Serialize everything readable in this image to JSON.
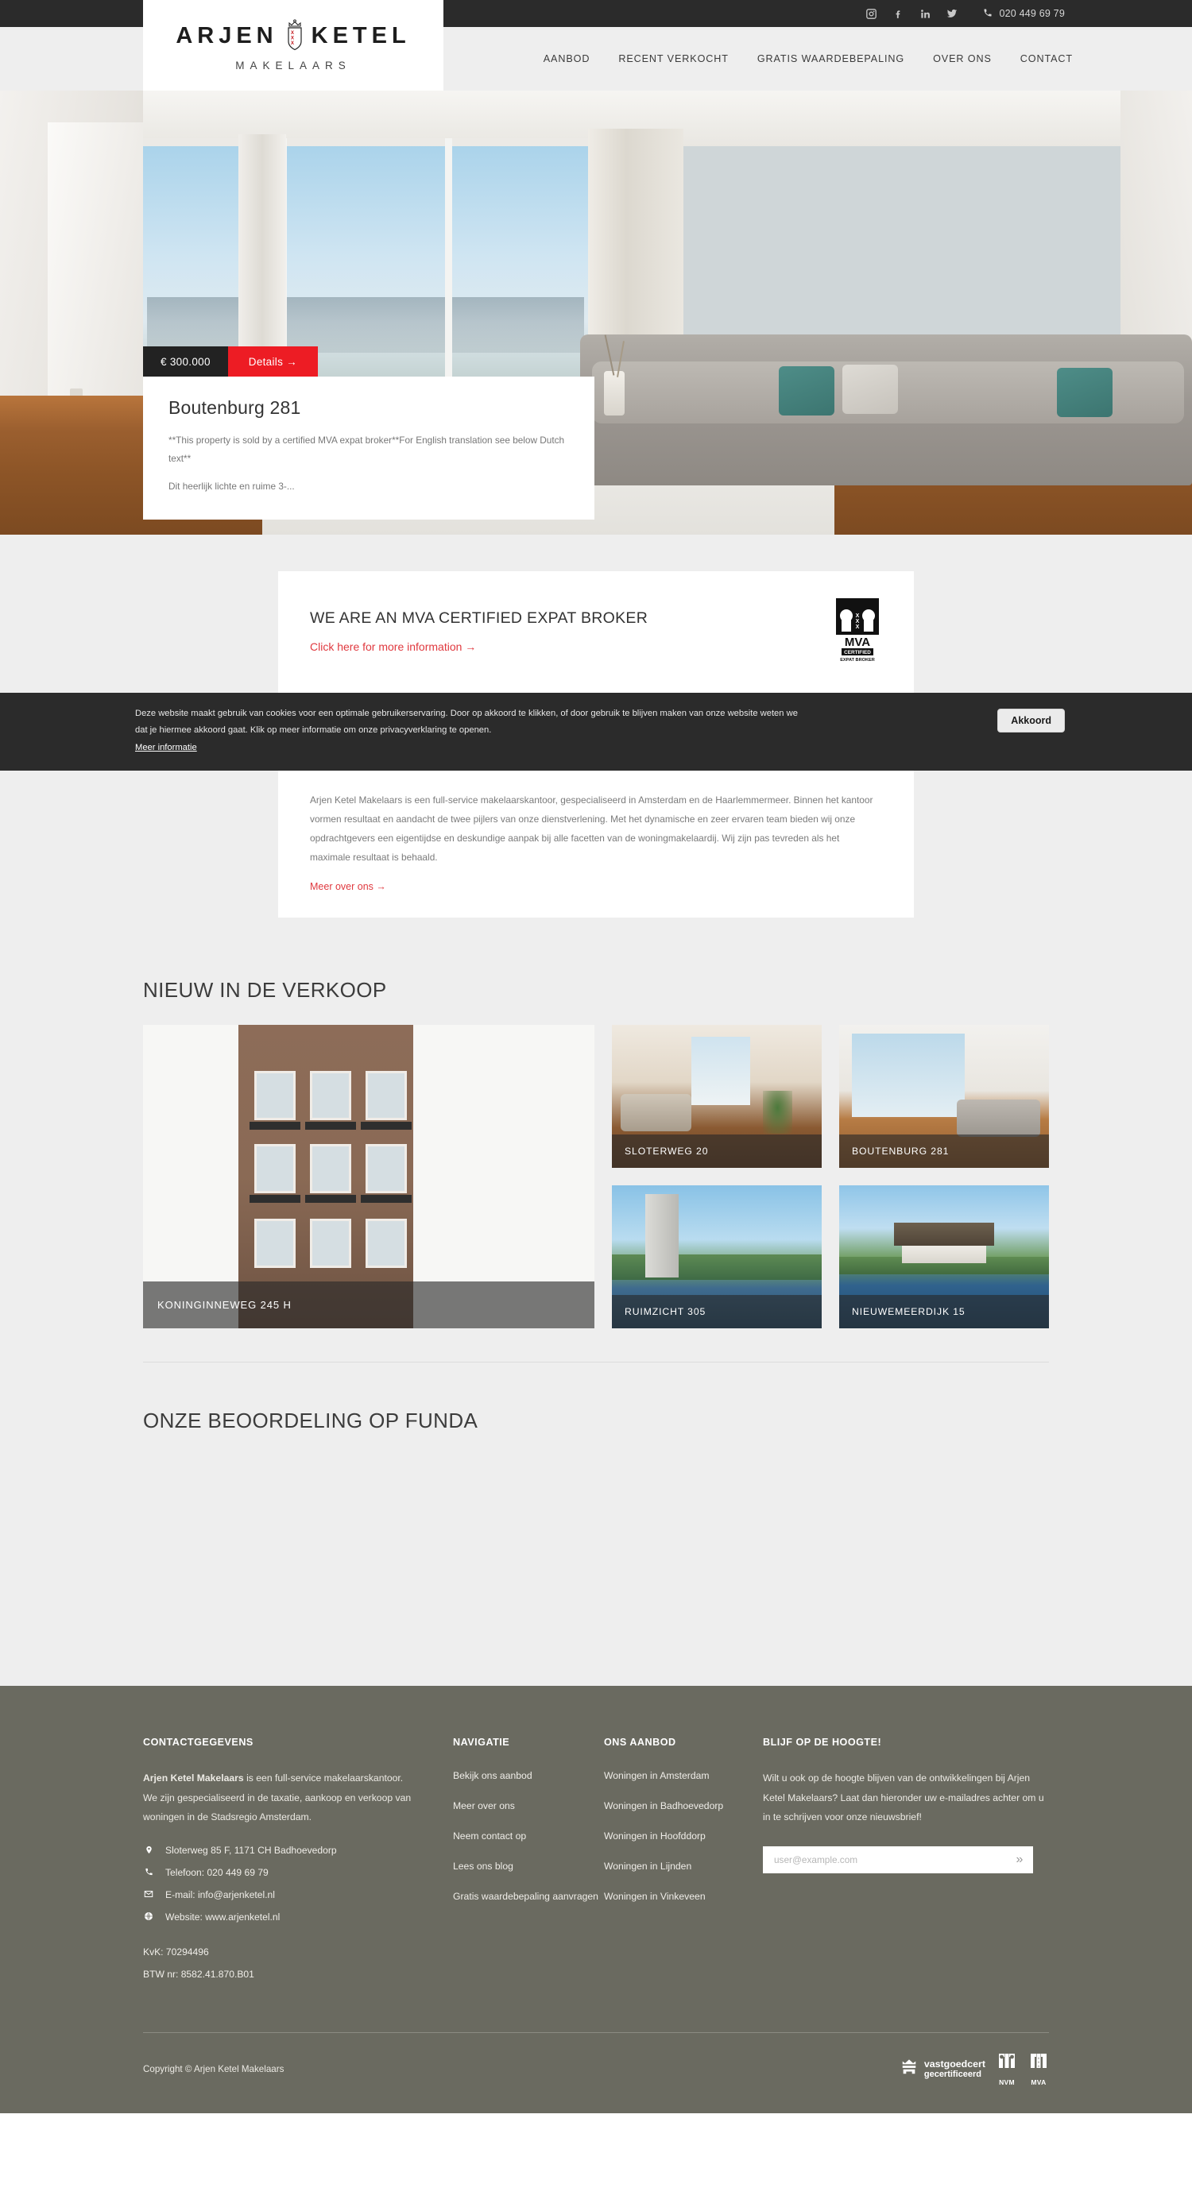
{
  "topbar": {
    "social": [
      {
        "name": "instagram-icon",
        "label": "Instagram"
      },
      {
        "name": "facebook-icon",
        "label": "Facebook"
      },
      {
        "name": "linkedin-icon",
        "label": "LinkedIn"
      },
      {
        "name": "twitter-icon",
        "label": "Twitter"
      }
    ],
    "phone": "020 449 69 79"
  },
  "logo": {
    "word1": "ARJEN",
    "word2": "KETEL",
    "tagline": "MAKELAARS"
  },
  "nav": [
    {
      "label": "AANBOD"
    },
    {
      "label": "RECENT VERKOCHT"
    },
    {
      "label": "GRATIS WAARDEBEPALING"
    },
    {
      "label": "OVER ONS"
    },
    {
      "label": "CONTACT"
    }
  ],
  "hero": {
    "price": "€ 300.000",
    "details_label": "Details →",
    "title": "Boutenburg 281",
    "desc1": "**This property is sold by a certified MVA expat broker**For English translation see below Dutch text**",
    "desc2": "Dit heerlijk lichte en ruime 3-..."
  },
  "mva": {
    "heading": "WE ARE AN MVA CERTIFIED EXPAT BROKER",
    "link": "Click here for more information →",
    "logo_alt": "MVA CERTIFIED EXPAT BROKER",
    "logo_line1": "MVA",
    "logo_line2": "CERTIFIED",
    "logo_line3": "EXPAT BROKER"
  },
  "cookie": {
    "text": "Deze website maakt gebruik van cookies voor een optimale gebruikerservaring. Door op akkoord te klikken, of door gebruik te blijven maken van onze website weten we dat je hiermee akkoord gaat. Klik op meer informatie om onze privacyverklaring te openen.",
    "more_link": "Meer informatie",
    "accept_button": "Akkoord"
  },
  "intro": {
    "paragraph": "Arjen Ketel Makelaars is een full-service makelaarskantoor, gespecialiseerd in Amsterdam en de Haarlemmermeer. Binnen het kantoor vormen resultaat en aandacht de twee pijlers van onze dienstverlening. Met het dynamische en zeer ervaren team bieden wij onze opdrachtgevers een eigentijdse en deskundige aanpak bij alle facetten van de woningmakelaardij. Wij zijn pas tevreden als het maximale resultaat is behaald.",
    "link": "Meer over ons →"
  },
  "listings": {
    "heading": "NIEUW IN DE VERKOOP",
    "featured": {
      "label": "KONINGINNEWEG 245 H"
    },
    "items": [
      {
        "label": "SLOTERWEG 20"
      },
      {
        "label": "BOUTENBURG 281"
      },
      {
        "label": "RUIMZICHT 305"
      },
      {
        "label": "NIEUWEMEERDIJK 15"
      }
    ]
  },
  "funda": {
    "heading": "ONZE BEOORDELING OP FUNDA"
  },
  "footer": {
    "contact": {
      "heading": "CONTACTGEGEVENS",
      "company": "Arjen Ketel Makelaars",
      "blurb": " is een full-service makelaarskantoor. We zijn gespecialiseerd in de taxatie, aankoop en verkoop van woningen in de Stadsregio Amsterdam.",
      "address": "Sloterweg 85 F, 1171 CH Badhoevedorp",
      "phone": "Telefoon: 020 449 69 79",
      "email": "E-mail: info@arjenketel.nl",
      "website": "Website: www.arjenketel.nl",
      "kvk": "KvK: 70294496",
      "btw": "BTW nr: 8582.41.870.B01"
    },
    "navigation": {
      "heading": "NAVIGATIE",
      "links": [
        {
          "label": "Bekijk ons aanbod"
        },
        {
          "label": "Meer over ons"
        },
        {
          "label": "Neem contact op"
        },
        {
          "label": "Lees ons blog"
        },
        {
          "label": "Gratis waardebepaling aanvragen"
        }
      ]
    },
    "offer": {
      "heading": "ONS AANBOD",
      "links": [
        {
          "label": "Woningen in Amsterdam"
        },
        {
          "label": "Woningen in Badhoevedorp"
        },
        {
          "label": "Woningen in Hoofddorp"
        },
        {
          "label": "Woningen in Lijnden"
        },
        {
          "label": "Woningen in Vinkeveen"
        }
      ]
    },
    "newsletter": {
      "heading": "BLIJF OP DE HOOGTE!",
      "text": "Wilt u ook op de hoogte blijven van de ontwikkelingen bij Arjen Ketel Makelaars? Laat dan hieronder uw e-mailadres achter om u in te schrijven voor onze nieuwsbrief!",
      "placeholder": "user@example.com",
      "value": "",
      "submit_label": "»"
    },
    "copyright": "Copyright © Arjen Ketel Makelaars",
    "certs": {
      "vastgoedcert_l1": "vastgoedcert",
      "vastgoedcert_l2": "gecertificeerd",
      "nvm": "NVM",
      "mva": "MVA"
    }
  },
  "colors": {
    "accent_red": "#ed1c24",
    "link_red": "#e0393f",
    "dark": "#2b2b2b",
    "footer_bg": "#6a6a60",
    "page_bg": "#eeeeee"
  }
}
